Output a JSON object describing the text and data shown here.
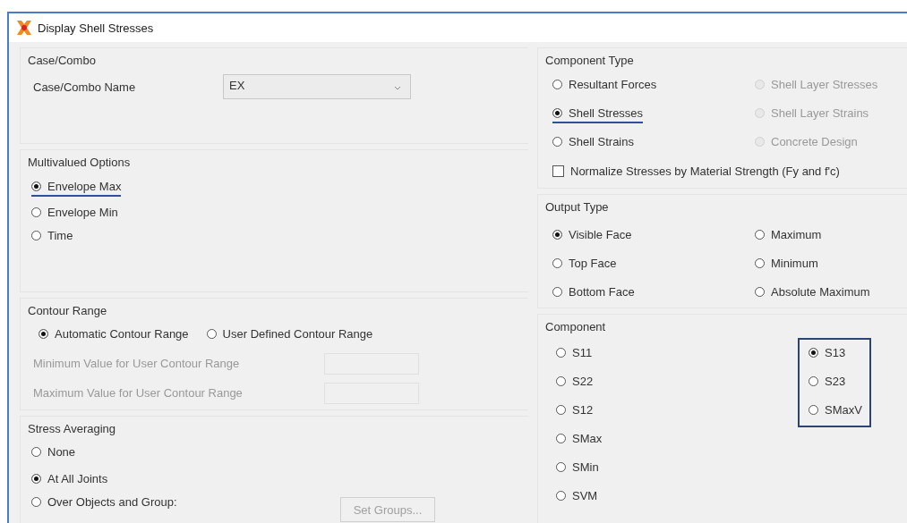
{
  "window": {
    "title": "Display Shell Stresses"
  },
  "case_combo": {
    "title": "Case/Combo",
    "label": "Case/Combo Name",
    "value": "EX"
  },
  "multivalued_options": {
    "title": "Multivalued Options",
    "options": [
      {
        "label": "Envelope Max",
        "selected": true,
        "underlined": true
      },
      {
        "label": "Envelope Min",
        "selected": false,
        "underlined": false
      },
      {
        "label": "Time",
        "selected": false,
        "underlined": false
      }
    ]
  },
  "contour_range": {
    "title": "Contour Range",
    "options": [
      {
        "label": "Automatic Contour Range",
        "selected": true
      },
      {
        "label": "User Defined Contour Range",
        "selected": false
      }
    ],
    "fields": [
      {
        "label": "Minimum Value for User Contour Range",
        "disabled": true
      },
      {
        "label": "Maximum Value for User Contour Range",
        "disabled": true
      }
    ]
  },
  "stress_averaging": {
    "title": "Stress Averaging",
    "options": [
      {
        "label": "None",
        "selected": false
      },
      {
        "label": "At All Joints",
        "selected": true
      },
      {
        "label": "Over Objects and Group:",
        "selected": false
      }
    ],
    "button": {
      "label": "Set Groups...",
      "disabled": true
    }
  },
  "component_type": {
    "title": "Component Type",
    "options": [
      {
        "label": "Resultant Forces",
        "selected": false,
        "disabled": false,
        "underlined": false
      },
      {
        "label": "Shell Layer Stresses",
        "selected": false,
        "disabled": true,
        "underlined": false
      },
      {
        "label": "Shell Stresses",
        "selected": true,
        "disabled": false,
        "underlined": true
      },
      {
        "label": "Shell Layer Strains",
        "selected": false,
        "disabled": true,
        "underlined": false
      },
      {
        "label": "Shell Strains",
        "selected": false,
        "disabled": false,
        "underlined": false
      },
      {
        "label": "Concrete Design",
        "selected": false,
        "disabled": true,
        "underlined": false
      }
    ],
    "checkbox": {
      "label": "Normalize Stresses by Material Strength (Fy and f'c)",
      "checked": false
    }
  },
  "output_type": {
    "title": "Output Type",
    "options": [
      {
        "label": "Visible Face",
        "selected": true
      },
      {
        "label": "Maximum",
        "selected": false
      },
      {
        "label": "Top Face",
        "selected": false
      },
      {
        "label": "Minimum",
        "selected": false
      },
      {
        "label": "Bottom Face",
        "selected": false
      },
      {
        "label": "Absolute Maximum",
        "selected": false
      }
    ]
  },
  "component": {
    "title": "Component",
    "columns": [
      {
        "highlighted": false,
        "options": [
          {
            "label": "S11",
            "selected": false
          },
          {
            "label": "S22",
            "selected": false
          },
          {
            "label": "S12",
            "selected": false
          },
          {
            "label": "SMax",
            "selected": false
          },
          {
            "label": "SMin",
            "selected": false
          },
          {
            "label": "SVM",
            "selected": false
          }
        ]
      },
      {
        "highlighted": true,
        "options": [
          {
            "label": "S13",
            "selected": true
          },
          {
            "label": "S23",
            "selected": false
          },
          {
            "label": "SMaxV",
            "selected": false
          }
        ]
      }
    ]
  }
}
